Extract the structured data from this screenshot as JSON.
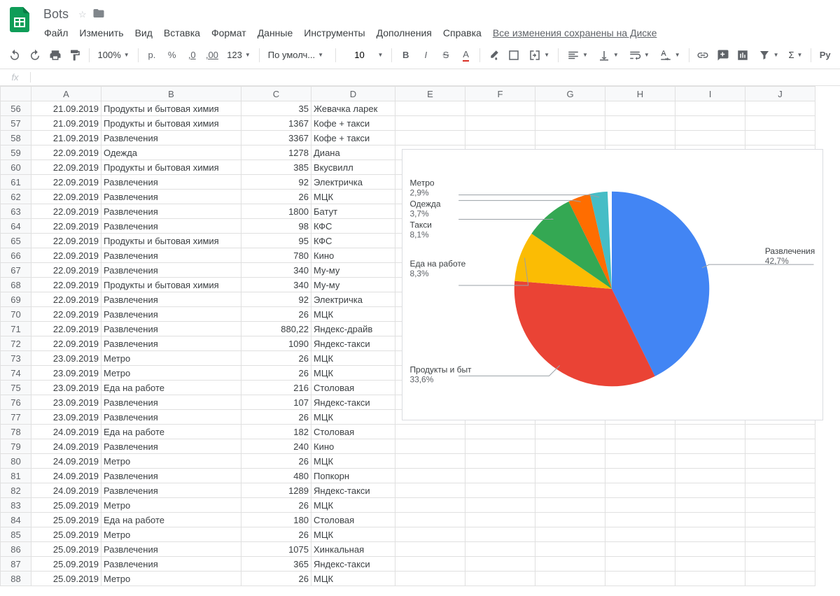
{
  "header": {
    "title": "Bots",
    "save_status": "Все изменения сохранены на Диске"
  },
  "menu": {
    "file": "Файл",
    "edit": "Изменить",
    "view": "Вид",
    "insert": "Вставка",
    "format": "Формат",
    "data": "Данные",
    "tools": "Инструменты",
    "addons": "Дополнения",
    "help": "Справка"
  },
  "toolbar": {
    "zoom": "100%",
    "currency": "р.",
    "percent": "%",
    "dec_dec": ",0",
    "dec_inc": ",00",
    "num_format": "123",
    "font": "По умолч...",
    "font_size": "10"
  },
  "columns": [
    "A",
    "B",
    "C",
    "D",
    "E",
    "F",
    "G",
    "H",
    "I",
    "J"
  ],
  "rows": [
    {
      "n": 56,
      "a": "21.09.2019",
      "b": "Продукты и бытовая химия",
      "c": "35",
      "d": "Жевачка ларек"
    },
    {
      "n": 57,
      "a": "21.09.2019",
      "b": "Продукты и бытовая химия",
      "c": "1367",
      "d": "Кофе + такси"
    },
    {
      "n": 58,
      "a": "21.09.2019",
      "b": "Развлечения",
      "c": "3367",
      "d": "Кофе + такси"
    },
    {
      "n": 59,
      "a": "22.09.2019",
      "b": "Одежда",
      "c": "1278",
      "d": "Диана"
    },
    {
      "n": 60,
      "a": "22.09.2019",
      "b": "Продукты и бытовая химия",
      "c": "385",
      "d": "Вкусвилл"
    },
    {
      "n": 61,
      "a": "22.09.2019",
      "b": "Развлечения",
      "c": "92",
      "d": "Электричка"
    },
    {
      "n": 62,
      "a": "22.09.2019",
      "b": "Развлечения",
      "c": "26",
      "d": "МЦК"
    },
    {
      "n": 63,
      "a": "22.09.2019",
      "b": "Развлечения",
      "c": "1800",
      "d": "Батут"
    },
    {
      "n": 64,
      "a": "22.09.2019",
      "b": "Развлечения",
      "c": "98",
      "d": "КФС"
    },
    {
      "n": 65,
      "a": "22.09.2019",
      "b": "Продукты и бытовая химия",
      "c": "95",
      "d": "КФС"
    },
    {
      "n": 66,
      "a": "22.09.2019",
      "b": "Развлечения",
      "c": "780",
      "d": "Кино"
    },
    {
      "n": 67,
      "a": "22.09.2019",
      "b": "Развлечения",
      "c": "340",
      "d": "Му-му"
    },
    {
      "n": 68,
      "a": "22.09.2019",
      "b": "Продукты и бытовая химия",
      "c": "340",
      "d": "Му-му"
    },
    {
      "n": 69,
      "a": "22.09.2019",
      "b": "Развлечения",
      "c": "92",
      "d": "Электричка"
    },
    {
      "n": 70,
      "a": "22.09.2019",
      "b": "Развлечения",
      "c": "26",
      "d": "МЦК"
    },
    {
      "n": 71,
      "a": "22.09.2019",
      "b": "Развлечения",
      "c": "880,22",
      "d": "Яндекс-драйв"
    },
    {
      "n": 72,
      "a": "22.09.2019",
      "b": "Развлечения",
      "c": "1090",
      "d": "Яндекс-такси"
    },
    {
      "n": 73,
      "a": "23.09.2019",
      "b": "Метро",
      "c": "26",
      "d": "МЦК"
    },
    {
      "n": 74,
      "a": "23.09.2019",
      "b": "Метро",
      "c": "26",
      "d": "МЦК"
    },
    {
      "n": 75,
      "a": "23.09.2019",
      "b": "Еда на работе",
      "c": "216",
      "d": "Столовая"
    },
    {
      "n": 76,
      "a": "23.09.2019",
      "b": "Развлечения",
      "c": "107",
      "d": "Яндекс-такси"
    },
    {
      "n": 77,
      "a": "23.09.2019",
      "b": "Развлечения",
      "c": "26",
      "d": "МЦК"
    },
    {
      "n": 78,
      "a": "24.09.2019",
      "b": "Еда на работе",
      "c": "182",
      "d": "Столовая"
    },
    {
      "n": 79,
      "a": "24.09.2019",
      "b": "Развлечения",
      "c": "240",
      "d": "Кино"
    },
    {
      "n": 80,
      "a": "24.09.2019",
      "b": "Метро",
      "c": "26",
      "d": "МЦК"
    },
    {
      "n": 81,
      "a": "24.09.2019",
      "b": "Развлечения",
      "c": "480",
      "d": "Попкорн"
    },
    {
      "n": 82,
      "a": "24.09.2019",
      "b": "Развлечения",
      "c": "1289",
      "d": "Яндекс-такси"
    },
    {
      "n": 83,
      "a": "25.09.2019",
      "b": "Метро",
      "c": "26",
      "d": "МЦК"
    },
    {
      "n": 84,
      "a": "25.09.2019",
      "b": "Еда на работе",
      "c": "180",
      "d": "Столовая"
    },
    {
      "n": 85,
      "a": "25.09.2019",
      "b": "Метро",
      "c": "26",
      "d": "МЦК"
    },
    {
      "n": 86,
      "a": "25.09.2019",
      "b": "Развлечения",
      "c": "1075",
      "d": "Хинкальная"
    },
    {
      "n": 87,
      "a": "25.09.2019",
      "b": "Развлечения",
      "c": "365",
      "d": "Яндекс-такси"
    },
    {
      "n": 88,
      "a": "25.09.2019",
      "b": "Метро",
      "c": "26",
      "d": "МЦК"
    }
  ],
  "chart_data": {
    "type": "pie",
    "series": [
      {
        "name": "Развлечения",
        "pct": 42.7,
        "pct_label": "42,7%",
        "color": "#4285f4"
      },
      {
        "name": "Продукты и быт",
        "pct": 33.6,
        "pct_label": "33,6%",
        "color": "#ea4335"
      },
      {
        "name": "Еда на работе",
        "pct": 8.3,
        "pct_label": "8,3%",
        "color": "#fbbc04"
      },
      {
        "name": "Такси",
        "pct": 8.1,
        "pct_label": "8,1%",
        "color": "#34a853"
      },
      {
        "name": "Одежда",
        "pct": 3.7,
        "pct_label": "3,7%",
        "color": "#ff6d00"
      },
      {
        "name": "Метро",
        "pct": 2.9,
        "pct_label": "2,9%",
        "color": "#46bdc6"
      }
    ]
  }
}
